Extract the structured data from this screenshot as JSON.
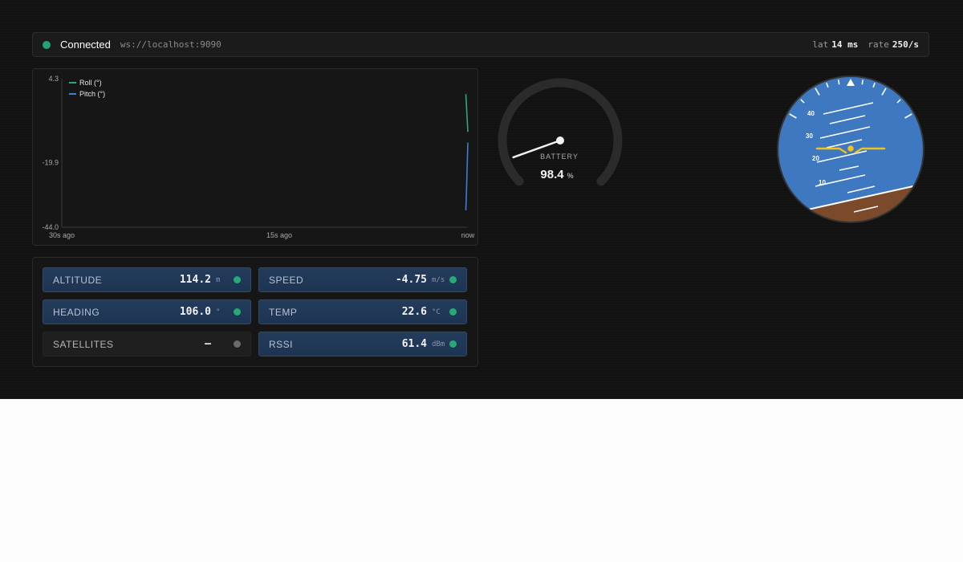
{
  "status": {
    "connection": "Connected",
    "url": "ws://localhost:9090",
    "latency_label": "lat",
    "latency_value": "14 ms",
    "rate_label": "rate",
    "rate_value": "250/s",
    "connected_color": "#23a474"
  },
  "chart_data": {
    "type": "line",
    "y_ticks": [
      "4.3",
      "-19.9",
      "-44.0"
    ],
    "ylim": [
      -44.0,
      4.3
    ],
    "x_ticks": [
      "30s ago",
      "15s ago",
      "now"
    ],
    "legend_position": "top-left",
    "series": [
      {
        "name": "Roll (°)",
        "color": "#2fa57d",
        "x": [
          29.85,
          30.0
        ],
        "values": [
          -0.7,
          -13.0
        ]
      },
      {
        "name": "Pitch (°)",
        "color": "#3a7fd0",
        "x": [
          29.85,
          29.9,
          30.0
        ],
        "values": [
          -38.5,
          -32.0,
          -16.5
        ]
      }
    ]
  },
  "telemetry": [
    {
      "label": "ALTITUDE",
      "value": "114.2",
      "unit": "m",
      "active": true
    },
    {
      "label": "SPEED",
      "value": "-4.75",
      "unit": "m/s",
      "active": true
    },
    {
      "label": "HEADING",
      "value": "106.0",
      "unit": "°",
      "active": true
    },
    {
      "label": "TEMP",
      "value": "22.6",
      "unit": "°C",
      "active": true
    },
    {
      "label": "SATELLITES",
      "value": "—",
      "unit": "",
      "active": false
    },
    {
      "label": "RSSI",
      "value": "61.4",
      "unit": "dBm",
      "active": true
    }
  ],
  "battery": {
    "label": "BATTERY",
    "value": "98.4",
    "unit": "%",
    "level_percent": 98.4
  },
  "attitude": {
    "pitch_labels": [
      "40",
      "30",
      "20",
      "10"
    ],
    "sky_color": "#3d78c0",
    "ground_color": "#7b4a2b",
    "aircraft_color": "#f2c21b"
  }
}
